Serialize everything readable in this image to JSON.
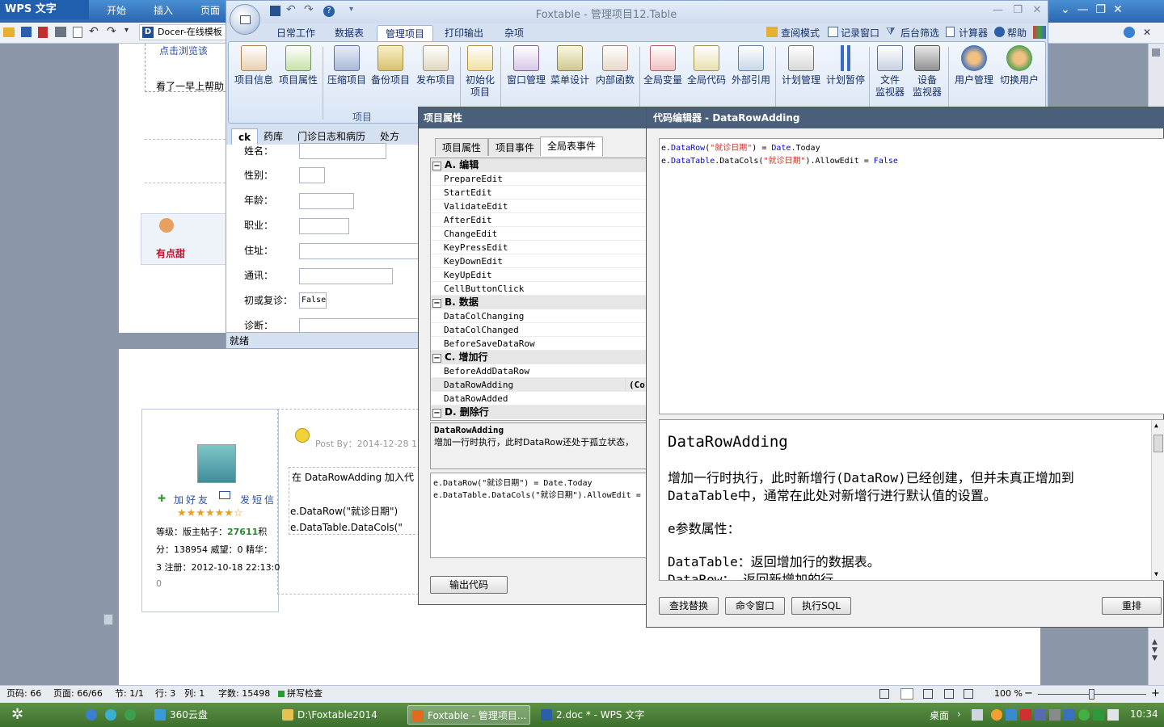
{
  "wps": {
    "logo": "WPS 文字",
    "tabs": [
      "开始",
      "插入",
      "页面"
    ],
    "docer": "Docer-在线模板",
    "doc_text1": "点击浏览该",
    "doc_text2": "看了一早上帮助",
    "user_name": "有点甜",
    "post_by": "Post By：2014-12-28 15",
    "post_line1": "在 DataRowAdding 加入代",
    "post_line2": "e.DataRow(\"就诊日期\")",
    "post_line3": "e.DataTable.DataCols(\"",
    "add_friend": "加好友",
    "send_msg": "发短信",
    "stars": "★★★★★★☆",
    "level_line1a": "等级：版主帖子：",
    "level_posts": "27611",
    "level_line1b": "积",
    "level_line2": "分：138954 威望：0 精华：",
    "level_line3": "3 注册：2012-10-18  22:13:0",
    "level_line4": "0"
  },
  "statusbar": {
    "page_code": "页码: 66",
    "page": "页面: 66/66",
    "section": "节: 1/1",
    "line": "行: 3",
    "col": "列: 1",
    "words": "字数: 15498",
    "spellcheck": "拼写检查",
    "zoom": "100 %"
  },
  "taskbar": {
    "items": [
      "360云盘",
      "D:\\Foxtable2014",
      "Foxtable - 管理项目...",
      "2.doc * - WPS 文字"
    ],
    "desktop": "桌面",
    "clock": "10:34"
  },
  "foxtable": {
    "title": "Foxtable - 管理项目12.Table",
    "tabs": [
      "日常工作",
      "数据表",
      "管理项目",
      "打印输出",
      "杂项"
    ],
    "right_tools": [
      "查阅模式",
      "记录窗口",
      "后台筛选",
      "计算器",
      "帮助"
    ],
    "ribbon_buttons": [
      "项目信息",
      "项目属性",
      "压缩项目",
      "备份项目",
      "发布项目",
      "初始化\n项目",
      "窗口管理",
      "菜单设计",
      "内部函数",
      "全局变量",
      "全局代码",
      "外部引用",
      "计划管理",
      "计划暂停",
      "文件\n监视器",
      "设备\n监视器",
      "用户管理",
      "切换用户"
    ],
    "group_label": "项目",
    "content_tabs": [
      "ck",
      "药库",
      "门诊日志和病历",
      "处方"
    ],
    "form_labels": [
      "姓名：",
      "性别：",
      "年龄：",
      "职业：",
      "住址：",
      "通讯：",
      "初或复诊：",
      "诊断："
    ],
    "false_value": "False",
    "status": "就绪"
  },
  "props": {
    "title": "项目属性",
    "tabs": [
      "项目属性",
      "项目事件",
      "全局表事件"
    ],
    "categories": [
      {
        "label": "A. 编辑",
        "items": [
          "PrepareEdit",
          "StartEdit",
          "ValidateEdit",
          "AfterEdit",
          "ChangeEdit",
          "KeyPressEdit",
          "KeyDownEdit",
          "KeyUpEdit",
          "CellButtonClick"
        ]
      },
      {
        "label": "B. 数据",
        "items": [
          "DataColChanging",
          "DataColChanged",
          "BeforeSaveDataRow"
        ]
      },
      {
        "label": "C. 增加行",
        "items": [
          "BeforeAddDataRow",
          "DataRowAdding",
          "DataRowAdded"
        ]
      },
      {
        "label": "D. 删除行",
        "items": []
      }
    ],
    "selected_value": "(Co",
    "desc_title": "DataRowAdding",
    "desc_text": "增加一行时执行，此时DataRow还处于孤立状态，",
    "code_line1": "e.DataRow(\"就诊日期\") = Date.Today",
    "code_line2": "e.DataTable.DataCols(\"就诊日期\").AllowEdit = ",
    "output_button": "输出代码"
  },
  "editor": {
    "title": "代码编辑器 - DataRowAdding",
    "help_title": "DataRowAdding",
    "help_p1": "增加一行时执行，此时新增行(DataRow)已经创建，但并未真正增加到",
    "help_p2": "DataTable中，通常在此处对新增行进行默认值的设置。",
    "help_p3": "e参数属性：",
    "help_p4": "DataTable：返回增加行的数据表。",
    "help_p5": "DataRow：  返回新增加的行。",
    "buttons": [
      "查找替换",
      "命令窗口",
      "执行SQL",
      "重排"
    ]
  }
}
